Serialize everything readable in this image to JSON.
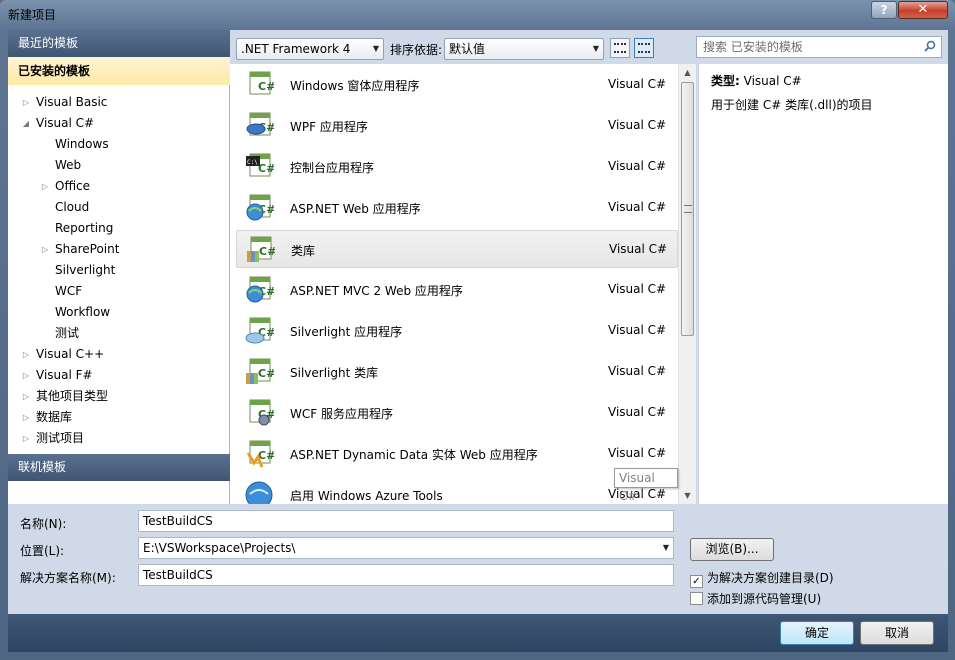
{
  "window": {
    "title": "新建项目",
    "help_label": "?",
    "close_label": "✕"
  },
  "left_panel": {
    "recent_header": "最近的模板",
    "installed_header": "已安装的模板",
    "online_header": "联机模板",
    "tree": [
      {
        "label": "Visual Basic",
        "level": 1,
        "arrow": "▷"
      },
      {
        "label": "Visual C#",
        "level": 1,
        "arrow": "◢"
      },
      {
        "label": "Windows",
        "level": 2,
        "arrow": ""
      },
      {
        "label": "Web",
        "level": 2,
        "arrow": ""
      },
      {
        "label": "Office",
        "level": 2,
        "arrow": "▷"
      },
      {
        "label": "Cloud",
        "level": 2,
        "arrow": ""
      },
      {
        "label": "Reporting",
        "level": 2,
        "arrow": ""
      },
      {
        "label": "SharePoint",
        "level": 2,
        "arrow": "▷"
      },
      {
        "label": "Silverlight",
        "level": 2,
        "arrow": ""
      },
      {
        "label": "WCF",
        "level": 2,
        "arrow": ""
      },
      {
        "label": "Workflow",
        "level": 2,
        "arrow": ""
      },
      {
        "label": "测试",
        "level": 2,
        "arrow": ""
      },
      {
        "label": "Visual C++",
        "level": 1,
        "arrow": "▷"
      },
      {
        "label": "Visual F#",
        "level": 1,
        "arrow": "▷"
      },
      {
        "label": "其他项目类型",
        "level": 1,
        "arrow": "▷"
      },
      {
        "label": "数据库",
        "level": 1,
        "arrow": "▷"
      },
      {
        "label": "测试项目",
        "level": 1,
        "arrow": "▷"
      }
    ]
  },
  "toolbar": {
    "framework": ".NET Framework 4",
    "sort_label": "排序依据:",
    "sort_value": "默认值",
    "search_placeholder": "搜索 已安装的模板"
  },
  "templates": [
    {
      "name": "Windows 窗体应用程序",
      "lang": "Visual C#",
      "icon": "winforms-icon",
      "selected": false
    },
    {
      "name": "WPF 应用程序",
      "lang": "Visual C#",
      "icon": "wpf-icon",
      "selected": false
    },
    {
      "name": "控制台应用程序",
      "lang": "Visual C#",
      "icon": "console-icon",
      "selected": false
    },
    {
      "name": "ASP.NET Web 应用程序",
      "lang": "Visual C#",
      "icon": "aspnet-icon",
      "selected": false
    },
    {
      "name": "类库",
      "lang": "Visual C#",
      "icon": "class-library-icon",
      "selected": true
    },
    {
      "name": "ASP.NET MVC 2 Web 应用程序",
      "lang": "Visual C#",
      "icon": "aspnet-mvc-icon",
      "selected": false
    },
    {
      "name": "Silverlight 应用程序",
      "lang": "Visual C#",
      "icon": "silverlight-app-icon",
      "selected": false
    },
    {
      "name": "Silverlight 类库",
      "lang": "Visual C#",
      "icon": "silverlight-lib-icon",
      "selected": false
    },
    {
      "name": "WCF 服务应用程序",
      "lang": "Visual C#",
      "icon": "wcf-icon",
      "selected": false
    },
    {
      "name": "ASP.NET Dynamic Data 实体 Web 应用程序",
      "lang": "Visual C#",
      "icon": "dynamic-data-icon",
      "selected": false
    },
    {
      "name": "启用 Windows Azure Tools",
      "lang": "Visual C#",
      "icon": "azure-icon",
      "selected": false
    }
  ],
  "tooltip": "Visual C#",
  "details": {
    "type_label": "类型:",
    "type_value": "Visual C#",
    "description": "用于创建 C# 类库(.dll)的项目"
  },
  "form": {
    "name_label": "名称(N):",
    "name_value": "TestBuildCS",
    "location_label": "位置(L):",
    "location_value": "E:\\VSWorkspace\\Projects\\",
    "solution_label": "解决方案名称(M):",
    "solution_value": "TestBuildCS",
    "browse_label": "浏览(B)...",
    "create_dir_label": "为解决方案创建目录(D)",
    "create_dir_checked": true,
    "source_control_label": "添加到源代码管理(U)",
    "source_control_checked": false
  },
  "buttons": {
    "ok": "确定",
    "cancel": "取消"
  },
  "colors": {
    "selection_bg": "#e6e6e6",
    "header_bg": "#3f5572",
    "installed_bg": "#ffe9a8",
    "ok_border": "#3c7fb1"
  }
}
